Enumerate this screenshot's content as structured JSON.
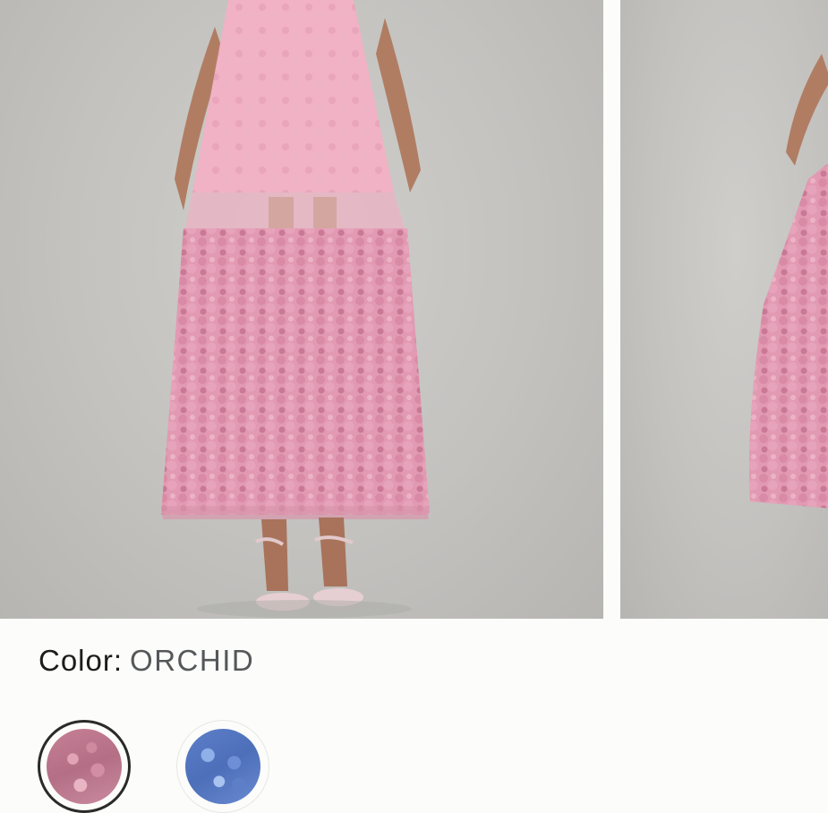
{
  "product": {
    "images": [
      {
        "name": "product-photo-main",
        "alt": ""
      },
      {
        "name": "product-photo-next",
        "alt": ""
      }
    ],
    "color": {
      "label": "Color:",
      "selected": "ORCHID"
    },
    "swatches": [
      {
        "name": "orchid",
        "selected": true,
        "color": "#c67f96"
      },
      {
        "name": "blue",
        "selected": false,
        "color": "#5d7fc9"
      }
    ]
  }
}
